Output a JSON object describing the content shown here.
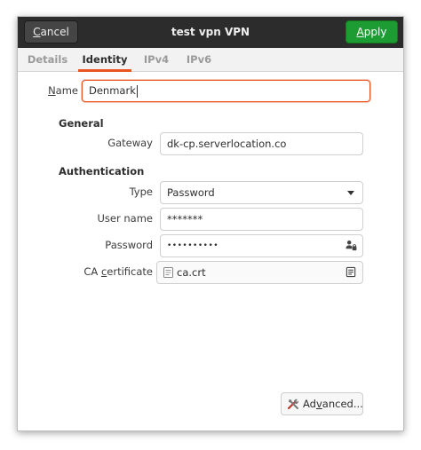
{
  "header": {
    "title": "test vpn VPN",
    "cancel_label": "Cancel",
    "cancel_mnemonic": "C",
    "cancel_rest": "ancel",
    "apply_label": "Apply",
    "apply_mnemonic": "A",
    "apply_rest": "pply"
  },
  "tabs": [
    {
      "label": "Details",
      "active": false
    },
    {
      "label": "Identity",
      "active": true
    },
    {
      "label": "IPv4",
      "active": false
    },
    {
      "label": "IPv6",
      "active": false
    }
  ],
  "name_field": {
    "label": "Name",
    "label_mnemonic": "N",
    "label_rest": "ame",
    "value": "Denmark"
  },
  "general": {
    "heading": "General",
    "gateway_label": "Gateway",
    "gateway_value": "dk-cp.serverlocation.co"
  },
  "authentication": {
    "heading": "Authentication",
    "type_label": "Type",
    "type_value": "Password",
    "username_label": "User name",
    "username_value": "*******",
    "password_label": "Password",
    "password_value": "••••••••••",
    "ca_label": "CA certificate",
    "ca_label_pre": "CA ",
    "ca_label_mnemonic": "c",
    "ca_label_rest": "ertificate",
    "ca_value": "ca.crt"
  },
  "advanced": {
    "label": "Advanced...",
    "label_pre": "Ad",
    "label_mnemonic": "v",
    "label_rest": "anced..."
  },
  "icons": {
    "advanced": "tools-icon",
    "password_options": "user-lock-icon",
    "file_chooser": "document-icon",
    "dropdown": "chevron-down-icon"
  },
  "colors": {
    "titlebar": "#2c2c2c",
    "apply": "#1e9c34",
    "accent": "#e95420"
  }
}
